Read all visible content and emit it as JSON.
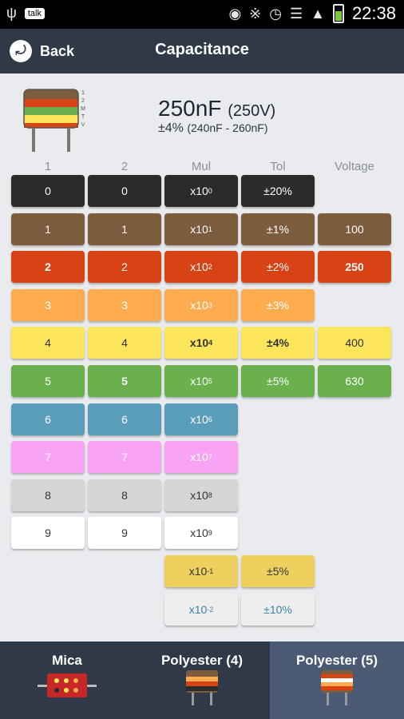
{
  "status_bar": {
    "talk_label": "talk",
    "time": "22:38"
  },
  "action_bar": {
    "back_label": "Back",
    "title": "Capacitance"
  },
  "summary": {
    "value": "250nF",
    "voltage": "(250V)",
    "tolerance": "±4%",
    "range": "(240nF - 260nF)",
    "icon_side_labels": [
      "1",
      "2",
      "M",
      "T",
      "V"
    ]
  },
  "columns": [
    "1",
    "2",
    "Mul",
    "Tol",
    "Voltage"
  ],
  "digit1": [
    {
      "label": "0",
      "bg": "#2b2b2b",
      "fg": "#ffffff"
    },
    {
      "label": "1",
      "bg": "#7c5c3c",
      "fg": "#ffffff"
    },
    {
      "label": "2",
      "bg": "#d84315",
      "fg": "#ffffff",
      "selected": true
    },
    {
      "label": "3",
      "bg": "#ffab4f",
      "fg": "#ffffff"
    },
    {
      "label": "4",
      "bg": "#fbe55b",
      "fg": "#333333"
    },
    {
      "label": "5",
      "bg": "#6ab04c",
      "fg": "#ffffff"
    },
    {
      "label": "6",
      "bg": "#5a9dbb",
      "fg": "#ffffff"
    },
    {
      "label": "7",
      "bg": "#f8a3f4",
      "fg": "#ffffff"
    },
    {
      "label": "8",
      "bg": "#d6d6d6",
      "fg": "#333333"
    },
    {
      "label": "9",
      "bg": "#ffffff",
      "fg": "#333333"
    }
  ],
  "digit2": [
    {
      "label": "0",
      "bg": "#2b2b2b",
      "fg": "#ffffff"
    },
    {
      "label": "1",
      "bg": "#7c5c3c",
      "fg": "#ffffff"
    },
    {
      "label": "2",
      "bg": "#d84315",
      "fg": "#ffffff"
    },
    {
      "label": "3",
      "bg": "#ffab4f",
      "fg": "#ffffff"
    },
    {
      "label": "4",
      "bg": "#fbe55b",
      "fg": "#333333"
    },
    {
      "label": "5",
      "bg": "#6ab04c",
      "fg": "#ffffff",
      "selected": true
    },
    {
      "label": "6",
      "bg": "#5a9dbb",
      "fg": "#ffffff"
    },
    {
      "label": "7",
      "bg": "#f8a3f4",
      "fg": "#ffffff"
    },
    {
      "label": "8",
      "bg": "#d6d6d6",
      "fg": "#333333"
    },
    {
      "label": "9",
      "bg": "#ffffff",
      "fg": "#333333"
    }
  ],
  "multiplier": [
    {
      "base": "x10",
      "exp": "0",
      "bg": "#2b2b2b",
      "fg": "#ffffff"
    },
    {
      "base": "x10",
      "exp": "1",
      "bg": "#7c5c3c",
      "fg": "#ffffff"
    },
    {
      "base": "x10",
      "exp": "2",
      "bg": "#d84315",
      "fg": "#ffffff"
    },
    {
      "base": "x10",
      "exp": "3",
      "bg": "#ffab4f",
      "fg": "#ffffff"
    },
    {
      "base": "x10",
      "exp": "4",
      "bg": "#fbe55b",
      "fg": "#333333",
      "selected": true
    },
    {
      "base": "x10",
      "exp": "5",
      "bg": "#6ab04c",
      "fg": "#ffffff"
    },
    {
      "base": "x10",
      "exp": "6",
      "bg": "#5a9dbb",
      "fg": "#ffffff"
    },
    {
      "base": "x10",
      "exp": "7",
      "bg": "#f8a3f4",
      "fg": "#ffffff"
    },
    {
      "base": "x10",
      "exp": "8",
      "bg": "#d6d6d6",
      "fg": "#333333"
    },
    {
      "base": "x10",
      "exp": "9",
      "bg": "#ffffff",
      "fg": "#333333"
    },
    {
      "base": "x10",
      "exp": "-1",
      "bg": "#edd05d",
      "fg": "#333333"
    },
    {
      "base": "x10",
      "exp": "-2",
      "bg": "#eeeeee",
      "fg": "#3a86a8"
    }
  ],
  "tolerance": [
    {
      "label": "±20%",
      "bg": "#2b2b2b",
      "fg": "#ffffff",
      "row": 0
    },
    {
      "label": "±1%",
      "bg": "#7c5c3c",
      "fg": "#ffffff",
      "row": 1
    },
    {
      "label": "±2%",
      "bg": "#d84315",
      "fg": "#ffffff",
      "row": 2
    },
    {
      "label": "±3%",
      "bg": "#ffab4f",
      "fg": "#ffffff",
      "row": 3
    },
    {
      "label": "±4%",
      "bg": "#fbe55b",
      "fg": "#333333",
      "row": 4,
      "selected": true
    },
    {
      "label": "±5%",
      "bg": "#6ab04c",
      "fg": "#ffffff",
      "row": 5
    },
    {
      "label": "±5%",
      "bg": "#edd05d",
      "fg": "#333333",
      "row": 10
    },
    {
      "label": "±10%",
      "bg": "#eeeeee",
      "fg": "#3a86a8",
      "row": 11
    }
  ],
  "voltage": [
    {
      "label": "100",
      "bg": "#7c5c3c",
      "fg": "#ffffff",
      "row": 1
    },
    {
      "label": "250",
      "bg": "#d84315",
      "fg": "#ffffff",
      "row": 2,
      "selected": true
    },
    {
      "label": "400",
      "bg": "#fbe55b",
      "fg": "#333333",
      "row": 4
    },
    {
      "label": "630",
      "bg": "#6ab04c",
      "fg": "#ffffff",
      "row": 5
    }
  ],
  "tabs": [
    {
      "label": "Mica",
      "active": false
    },
    {
      "label": "Polyester (4)",
      "active": false
    },
    {
      "label": "Polyester (5)",
      "active": true
    }
  ]
}
